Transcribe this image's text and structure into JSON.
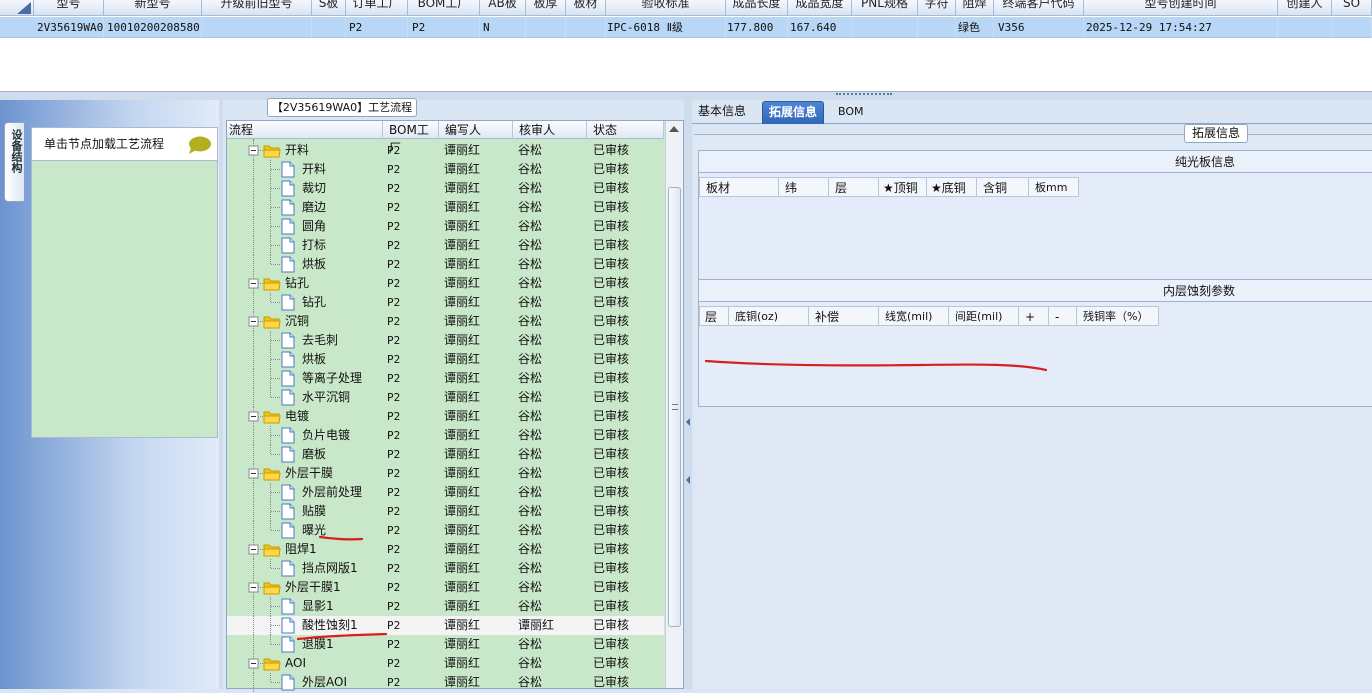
{
  "top_grid": {
    "columns": [
      "型号",
      "新型号",
      "升级前旧型号",
      "S板",
      "订单工厂",
      "BOM工厂",
      "AB板",
      "板厚",
      "板材",
      "验收标准",
      "成品长度",
      "成品宽度",
      "PNL规格",
      "字符",
      "阻焊",
      "终端客户代码",
      "型号创建时间",
      "创建人",
      "SO"
    ],
    "row": {
      "model": "2V35619WA0",
      "new_model": "10010200208580",
      "old_model": "",
      "s_board": "",
      "order_factory": "P2",
      "bom_factory": "P2",
      "ab_board": "N",
      "thickness": "",
      "material": "",
      "standard": "IPC-6018 Ⅱ级",
      "length": "177.800",
      "width": "167.640",
      "pnl": "",
      "char": "",
      "solder_mask": "绿色",
      "customer_code": "V356",
      "created": "2025-12-29 17:54:27",
      "creator": "",
      "so": ""
    }
  },
  "left_panel": {
    "vertical_tab": "设备结构",
    "hint": "单击节点加载工艺流程"
  },
  "flow_panel": {
    "title": "【2V35619WA0】工艺流程",
    "headers": [
      "流程",
      "BOM工厂",
      "编写人",
      "核审人",
      "状态"
    ],
    "rows": [
      {
        "name": "开料",
        "level": 1,
        "type": "folder",
        "factory": "P2",
        "writer": "谭丽红",
        "reviewer": "谷松",
        "status": "已审核"
      },
      {
        "name": "开料",
        "level": 2,
        "type": "file",
        "factory": "P2",
        "writer": "谭丽红",
        "reviewer": "谷松",
        "status": "已审核"
      },
      {
        "name": "裁切",
        "level": 2,
        "type": "file",
        "factory": "P2",
        "writer": "谭丽红",
        "reviewer": "谷松",
        "status": "已审核"
      },
      {
        "name": "磨边",
        "level": 2,
        "type": "file",
        "factory": "P2",
        "writer": "谭丽红",
        "reviewer": "谷松",
        "status": "已审核"
      },
      {
        "name": "圆角",
        "level": 2,
        "type": "file",
        "factory": "P2",
        "writer": "谭丽红",
        "reviewer": "谷松",
        "status": "已审核"
      },
      {
        "name": "打标",
        "level": 2,
        "type": "file",
        "factory": "P2",
        "writer": "谭丽红",
        "reviewer": "谷松",
        "status": "已审核"
      },
      {
        "name": "烘板",
        "level": 2,
        "type": "file",
        "factory": "P2",
        "writer": "谭丽红",
        "reviewer": "谷松",
        "status": "已审核"
      },
      {
        "name": "钻孔",
        "level": 1,
        "type": "folder",
        "factory": "P2",
        "writer": "谭丽红",
        "reviewer": "谷松",
        "status": "已审核"
      },
      {
        "name": "钻孔",
        "level": 2,
        "type": "file",
        "factory": "P2",
        "writer": "谭丽红",
        "reviewer": "谷松",
        "status": "已审核"
      },
      {
        "name": "沉铜",
        "level": 1,
        "type": "folder",
        "factory": "P2",
        "writer": "谭丽红",
        "reviewer": "谷松",
        "status": "已审核"
      },
      {
        "name": "去毛刺",
        "level": 2,
        "type": "file",
        "factory": "P2",
        "writer": "谭丽红",
        "reviewer": "谷松",
        "status": "已审核"
      },
      {
        "name": "烘板",
        "level": 2,
        "type": "file",
        "factory": "P2",
        "writer": "谭丽红",
        "reviewer": "谷松",
        "status": "已审核"
      },
      {
        "name": "等离子处理",
        "level": 2,
        "type": "file",
        "factory": "P2",
        "writer": "谭丽红",
        "reviewer": "谷松",
        "status": "已审核"
      },
      {
        "name": "水平沉铜",
        "level": 2,
        "type": "file",
        "factory": "P2",
        "writer": "谭丽红",
        "reviewer": "谷松",
        "status": "已审核"
      },
      {
        "name": "电镀",
        "level": 1,
        "type": "folder",
        "factory": "P2",
        "writer": "谭丽红",
        "reviewer": "谷松",
        "status": "已审核"
      },
      {
        "name": "负片电镀",
        "level": 2,
        "type": "file",
        "factory": "P2",
        "writer": "谭丽红",
        "reviewer": "谷松",
        "status": "已审核"
      },
      {
        "name": "磨板",
        "level": 2,
        "type": "file",
        "factory": "P2",
        "writer": "谭丽红",
        "reviewer": "谷松",
        "status": "已审核"
      },
      {
        "name": "外层干膜",
        "level": 1,
        "type": "folder",
        "factory": "P2",
        "writer": "谭丽红",
        "reviewer": "谷松",
        "status": "已审核"
      },
      {
        "name": "外层前处理",
        "level": 2,
        "type": "file",
        "factory": "P2",
        "writer": "谭丽红",
        "reviewer": "谷松",
        "status": "已审核"
      },
      {
        "name": "贴膜",
        "level": 2,
        "type": "file",
        "factory": "P2",
        "writer": "谭丽红",
        "reviewer": "谷松",
        "status": "已审核"
      },
      {
        "name": "曝光",
        "level": 2,
        "type": "file",
        "factory": "P2",
        "writer": "谭丽红",
        "reviewer": "谷松",
        "status": "已审核"
      },
      {
        "name": "阻焊1",
        "level": 1,
        "type": "folder",
        "factory": "P2",
        "writer": "谭丽红",
        "reviewer": "谷松",
        "status": "已审核"
      },
      {
        "name": "挡点网版1",
        "level": 2,
        "type": "file",
        "factory": "P2",
        "writer": "谭丽红",
        "reviewer": "谷松",
        "status": "已审核"
      },
      {
        "name": "外层干膜1",
        "level": 1,
        "type": "folder",
        "factory": "P2",
        "writer": "谭丽红",
        "reviewer": "谷松",
        "status": "已审核"
      },
      {
        "name": "显影1",
        "level": 2,
        "type": "file",
        "factory": "P2",
        "writer": "谭丽红",
        "reviewer": "谷松",
        "status": "已审核"
      },
      {
        "name": "酸性蚀刻1",
        "level": 2,
        "type": "file",
        "factory": "P2",
        "writer": "谭丽红",
        "reviewer": "谭丽红",
        "status": "已审核",
        "selected": true
      },
      {
        "name": "退膜1",
        "level": 2,
        "type": "file",
        "factory": "P2",
        "writer": "谭丽红",
        "reviewer": "谷松",
        "status": "已审核"
      },
      {
        "name": "AOI",
        "level": 1,
        "type": "folder",
        "factory": "P2",
        "writer": "谭丽红",
        "reviewer": "谷松",
        "status": "已审核"
      },
      {
        "name": "外层AOI",
        "level": 2,
        "type": "file",
        "factory": "P2",
        "writer": "谭丽红",
        "reviewer": "谷松",
        "status": "已审核"
      }
    ]
  },
  "right_panel": {
    "tabs": [
      "基本信息",
      "拓展信息",
      "BOM"
    ],
    "active_tab": "拓展信息",
    "section_title": "拓展信息",
    "box1": {
      "title": "纯光板信息",
      "columns": [
        "板材",
        "纬",
        "层",
        "★顶铜",
        "★底铜",
        "含铜",
        "板mm"
      ]
    },
    "box2": {
      "title": "内层蚀刻参数",
      "columns": [
        "层",
        "底铜(oz)",
        "补偿",
        "线宽(mil)",
        "间距(mil)",
        "+",
        "-",
        "残铜率（%）"
      ]
    }
  },
  "colors": {
    "selected_row": "#b8d6f5",
    "tree_bg": "#c9e8c9",
    "active_tab": "#2f66b9",
    "annotation_red": "#d81e1e"
  }
}
